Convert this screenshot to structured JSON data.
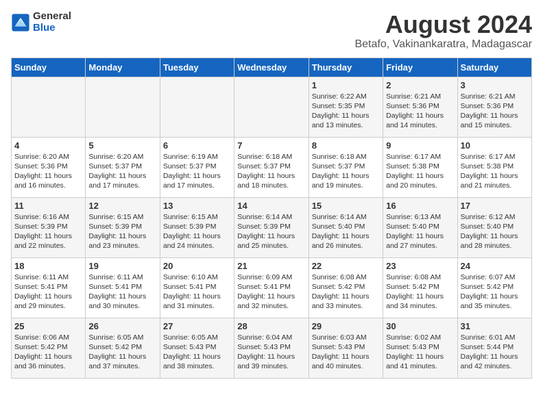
{
  "logo": {
    "general": "General",
    "blue": "Blue"
  },
  "title": "August 2024",
  "subtitle": "Betafo, Vakinankaratra, Madagascar",
  "days_of_week": [
    "Sunday",
    "Monday",
    "Tuesday",
    "Wednesday",
    "Thursday",
    "Friday",
    "Saturday"
  ],
  "weeks": [
    [
      {
        "day": "",
        "detail": ""
      },
      {
        "day": "",
        "detail": ""
      },
      {
        "day": "",
        "detail": ""
      },
      {
        "day": "",
        "detail": ""
      },
      {
        "day": "1",
        "detail": "Sunrise: 6:22 AM\nSunset: 5:35 PM\nDaylight: 11 hours\nand 13 minutes."
      },
      {
        "day": "2",
        "detail": "Sunrise: 6:21 AM\nSunset: 5:36 PM\nDaylight: 11 hours\nand 14 minutes."
      },
      {
        "day": "3",
        "detail": "Sunrise: 6:21 AM\nSunset: 5:36 PM\nDaylight: 11 hours\nand 15 minutes."
      }
    ],
    [
      {
        "day": "4",
        "detail": "Sunrise: 6:20 AM\nSunset: 5:36 PM\nDaylight: 11 hours\nand 16 minutes."
      },
      {
        "day": "5",
        "detail": "Sunrise: 6:20 AM\nSunset: 5:37 PM\nDaylight: 11 hours\nand 17 minutes."
      },
      {
        "day": "6",
        "detail": "Sunrise: 6:19 AM\nSunset: 5:37 PM\nDaylight: 11 hours\nand 17 minutes."
      },
      {
        "day": "7",
        "detail": "Sunrise: 6:18 AM\nSunset: 5:37 PM\nDaylight: 11 hours\nand 18 minutes."
      },
      {
        "day": "8",
        "detail": "Sunrise: 6:18 AM\nSunset: 5:37 PM\nDaylight: 11 hours\nand 19 minutes."
      },
      {
        "day": "9",
        "detail": "Sunrise: 6:17 AM\nSunset: 5:38 PM\nDaylight: 11 hours\nand 20 minutes."
      },
      {
        "day": "10",
        "detail": "Sunrise: 6:17 AM\nSunset: 5:38 PM\nDaylight: 11 hours\nand 21 minutes."
      }
    ],
    [
      {
        "day": "11",
        "detail": "Sunrise: 6:16 AM\nSunset: 5:39 PM\nDaylight: 11 hours\nand 22 minutes."
      },
      {
        "day": "12",
        "detail": "Sunrise: 6:15 AM\nSunset: 5:39 PM\nDaylight: 11 hours\nand 23 minutes."
      },
      {
        "day": "13",
        "detail": "Sunrise: 6:15 AM\nSunset: 5:39 PM\nDaylight: 11 hours\nand 24 minutes."
      },
      {
        "day": "14",
        "detail": "Sunrise: 6:14 AM\nSunset: 5:39 PM\nDaylight: 11 hours\nand 25 minutes."
      },
      {
        "day": "15",
        "detail": "Sunrise: 6:14 AM\nSunset: 5:40 PM\nDaylight: 11 hours\nand 26 minutes."
      },
      {
        "day": "16",
        "detail": "Sunrise: 6:13 AM\nSunset: 5:40 PM\nDaylight: 11 hours\nand 27 minutes."
      },
      {
        "day": "17",
        "detail": "Sunrise: 6:12 AM\nSunset: 5:40 PM\nDaylight: 11 hours\nand 28 minutes."
      }
    ],
    [
      {
        "day": "18",
        "detail": "Sunrise: 6:11 AM\nSunset: 5:41 PM\nDaylight: 11 hours\nand 29 minutes."
      },
      {
        "day": "19",
        "detail": "Sunrise: 6:11 AM\nSunset: 5:41 PM\nDaylight: 11 hours\nand 30 minutes."
      },
      {
        "day": "20",
        "detail": "Sunrise: 6:10 AM\nSunset: 5:41 PM\nDaylight: 11 hours\nand 31 minutes."
      },
      {
        "day": "21",
        "detail": "Sunrise: 6:09 AM\nSunset: 5:41 PM\nDaylight: 11 hours\nand 32 minutes."
      },
      {
        "day": "22",
        "detail": "Sunrise: 6:08 AM\nSunset: 5:42 PM\nDaylight: 11 hours\nand 33 minutes."
      },
      {
        "day": "23",
        "detail": "Sunrise: 6:08 AM\nSunset: 5:42 PM\nDaylight: 11 hours\nand 34 minutes."
      },
      {
        "day": "24",
        "detail": "Sunrise: 6:07 AM\nSunset: 5:42 PM\nDaylight: 11 hours\nand 35 minutes."
      }
    ],
    [
      {
        "day": "25",
        "detail": "Sunrise: 6:06 AM\nSunset: 5:42 PM\nDaylight: 11 hours\nand 36 minutes."
      },
      {
        "day": "26",
        "detail": "Sunrise: 6:05 AM\nSunset: 5:42 PM\nDaylight: 11 hours\nand 37 minutes."
      },
      {
        "day": "27",
        "detail": "Sunrise: 6:05 AM\nSunset: 5:43 PM\nDaylight: 11 hours\nand 38 minutes."
      },
      {
        "day": "28",
        "detail": "Sunrise: 6:04 AM\nSunset: 5:43 PM\nDaylight: 11 hours\nand 39 minutes."
      },
      {
        "day": "29",
        "detail": "Sunrise: 6:03 AM\nSunset: 5:43 PM\nDaylight: 11 hours\nand 40 minutes."
      },
      {
        "day": "30",
        "detail": "Sunrise: 6:02 AM\nSunset: 5:43 PM\nDaylight: 11 hours\nand 41 minutes."
      },
      {
        "day": "31",
        "detail": "Sunrise: 6:01 AM\nSunset: 5:44 PM\nDaylight: 11 hours\nand 42 minutes."
      }
    ]
  ]
}
